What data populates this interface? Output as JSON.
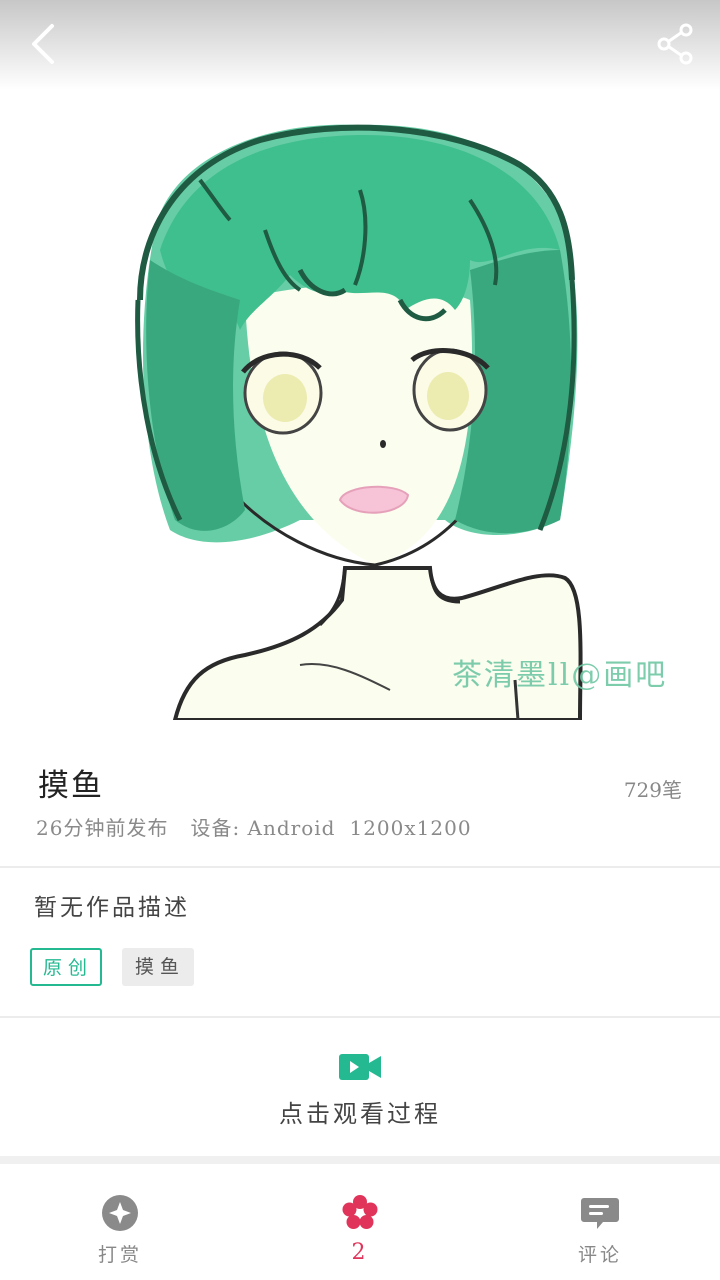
{
  "artwork": {
    "watermark": "茶清墨ll@画吧",
    "colors": {
      "hair": "#3fbf8e",
      "hair_dark": "#1f6b4f",
      "skin": "#fbfdee",
      "mouth": "#f7c3d6"
    }
  },
  "icons": {
    "back": "chevron-left-icon",
    "share": "share-icon",
    "video": "video-camera-icon",
    "reward": "coin-icon",
    "like": "flower-icon",
    "comment": "comment-icon"
  },
  "work": {
    "title": "摸鱼",
    "strokes": "729笔",
    "published": "26分钟前发布",
    "device": "设备: Android",
    "resolution": "1200x1200",
    "description": "暂无作品描述"
  },
  "tags": [
    "原创",
    "摸鱼"
  ],
  "process": {
    "label": "点击观看过程"
  },
  "bottom_bar": {
    "reward_label": "打赏",
    "like_count": "2",
    "comment_label": "评论"
  },
  "theme": {
    "accent": "#25b991",
    "like_color": "#e0345a",
    "icon_gray": "#8a8a8a"
  }
}
